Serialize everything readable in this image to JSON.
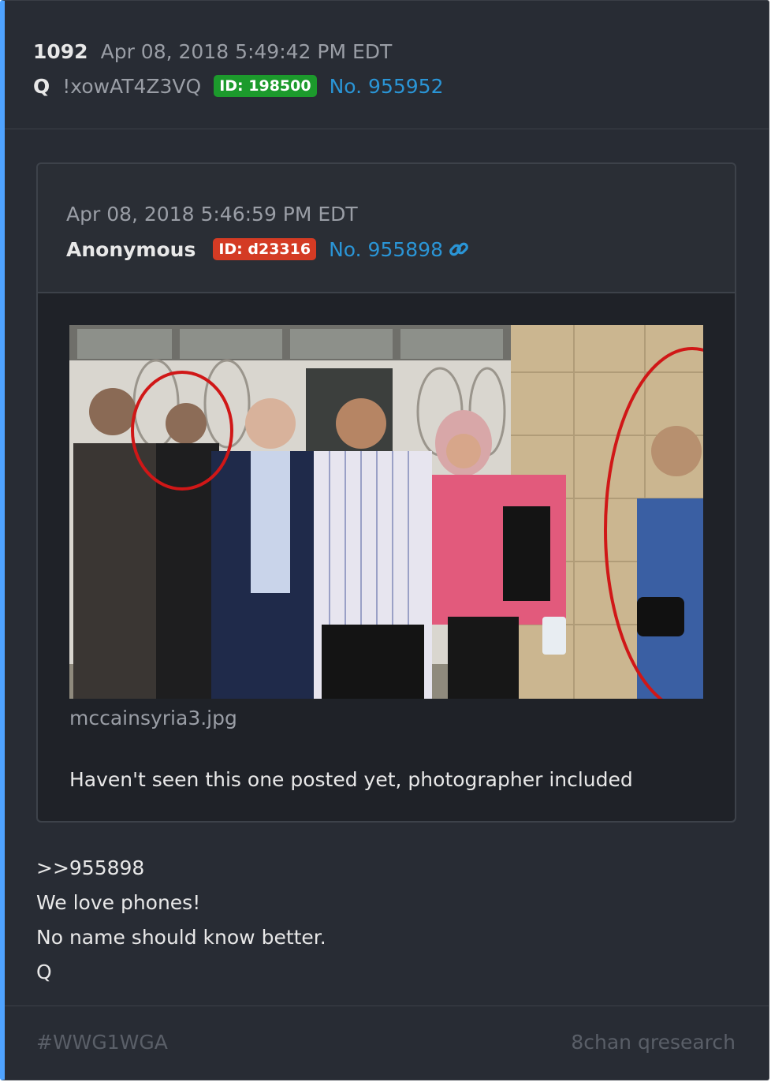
{
  "post": {
    "number": "1092",
    "date": "Apr 08, 2018 5:49:42 PM EDT",
    "name": "Q",
    "tripcode": "!xowAT4Z3VQ",
    "id_badge": "ID: 198500",
    "post_no": "No. 955952"
  },
  "quoted": {
    "date": "Apr 08, 2018 5:46:59 PM EDT",
    "name": "Anonymous",
    "id_badge": "ID: d23316",
    "post_no": "No. 955898",
    "link_icon": "link-icon",
    "filename": "mccainsyria3.jpg",
    "caption": "Haven't seen this one posted yet, photographer included"
  },
  "body": {
    "lines": [
      ">>955898",
      "We love phones!",
      "No name should know better.",
      "Q"
    ]
  },
  "footer": {
    "hashtag": "#WWG1WGA",
    "source": "8chan qresearch"
  },
  "colors": {
    "accent_blue": "#2a95d6",
    "badge_green": "#1c9a2c",
    "badge_red": "#d43b24",
    "background": "#282c34"
  }
}
